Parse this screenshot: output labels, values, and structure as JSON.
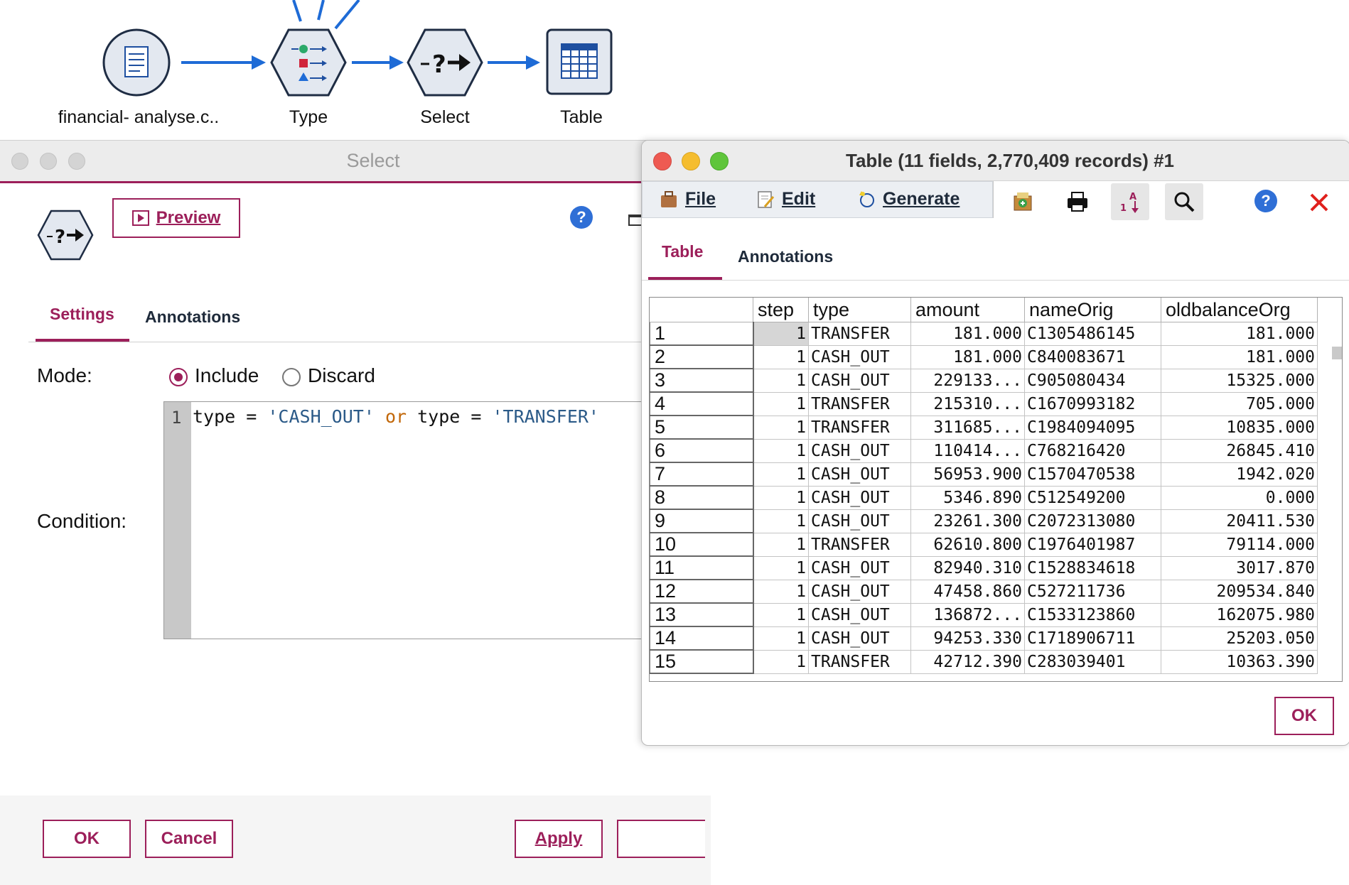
{
  "canvas": {
    "nodes": [
      {
        "label": "financial- analyse.c..",
        "icon": "source-file-icon"
      },
      {
        "label": "Type",
        "icon": "type-node-icon"
      },
      {
        "label": "Select",
        "icon": "select-node-icon"
      },
      {
        "label": "Table",
        "icon": "table-node-icon"
      }
    ]
  },
  "select_dialog": {
    "title": "Select",
    "preview_label": "Preview",
    "tabs": [
      {
        "label": "Settings"
      },
      {
        "label": "Annotations"
      }
    ],
    "mode_label": "Mode:",
    "mode_options": [
      {
        "label": "Include",
        "selected": true
      },
      {
        "label": "Discard",
        "selected": false
      }
    ],
    "condition_label": "Condition:",
    "line_number": "1",
    "condition_code": "type = 'CASH_OUT' or type = 'TRANSFER'",
    "code_tokens": {
      "a": "type = ",
      "b": "'CASH_OUT'",
      "c": " ",
      "d": "or",
      "e": " type = ",
      "f": "'TRANSFER'"
    },
    "buttons": {
      "ok": "OK",
      "cancel": "Cancel",
      "apply": "Apply"
    },
    "help": "?"
  },
  "table_window": {
    "title": "Table (11 fields, 2,770,409 records) #1",
    "menus": [
      {
        "label": "File"
      },
      {
        "label": "Edit"
      },
      {
        "label": "Generate"
      }
    ],
    "tabs": [
      {
        "label": "Table"
      },
      {
        "label": "Annotations"
      }
    ],
    "help": "?",
    "ok_label": "OK",
    "columns": [
      "",
      "step",
      "type",
      "amount",
      "nameOrig",
      "oldbalanceOrg"
    ],
    "rows": [
      [
        "1",
        "1",
        "TRANSFER",
        "181.000",
        "C1305486145",
        "181.000"
      ],
      [
        "2",
        "1",
        "CASH_OUT",
        "181.000",
        "C840083671",
        "181.000"
      ],
      [
        "3",
        "1",
        "CASH_OUT",
        "229133...",
        "C905080434",
        "15325.000"
      ],
      [
        "4",
        "1",
        "TRANSFER",
        "215310...",
        "C1670993182",
        "705.000"
      ],
      [
        "5",
        "1",
        "TRANSFER",
        "311685...",
        "C1984094095",
        "10835.000"
      ],
      [
        "6",
        "1",
        "CASH_OUT",
        "110414...",
        "C768216420",
        "26845.410"
      ],
      [
        "7",
        "1",
        "CASH_OUT",
        "56953.900",
        "C1570470538",
        "1942.020"
      ],
      [
        "8",
        "1",
        "CASH_OUT",
        "5346.890",
        "C512549200",
        "0.000"
      ],
      [
        "9",
        "1",
        "CASH_OUT",
        "23261.300",
        "C2072313080",
        "20411.530"
      ],
      [
        "10",
        "1",
        "TRANSFER",
        "62610.800",
        "C1976401987",
        "79114.000"
      ],
      [
        "11",
        "1",
        "CASH_OUT",
        "82940.310",
        "C1528834618",
        "3017.870"
      ],
      [
        "12",
        "1",
        "CASH_OUT",
        "47458.860",
        "C527211736",
        "209534.840"
      ],
      [
        "13",
        "1",
        "CASH_OUT",
        "136872...",
        "C1533123860",
        "162075.980"
      ],
      [
        "14",
        "1",
        "CASH_OUT",
        "94253.330",
        "C1718906711",
        "25203.050"
      ],
      [
        "15",
        "1",
        "TRANSFER",
        "42712.390",
        "C283039401",
        "10363.390"
      ]
    ]
  },
  "colors": {
    "accent": "#9c1f5a",
    "node_blue": "#1e6bd6",
    "close_red": "#e0201c"
  }
}
